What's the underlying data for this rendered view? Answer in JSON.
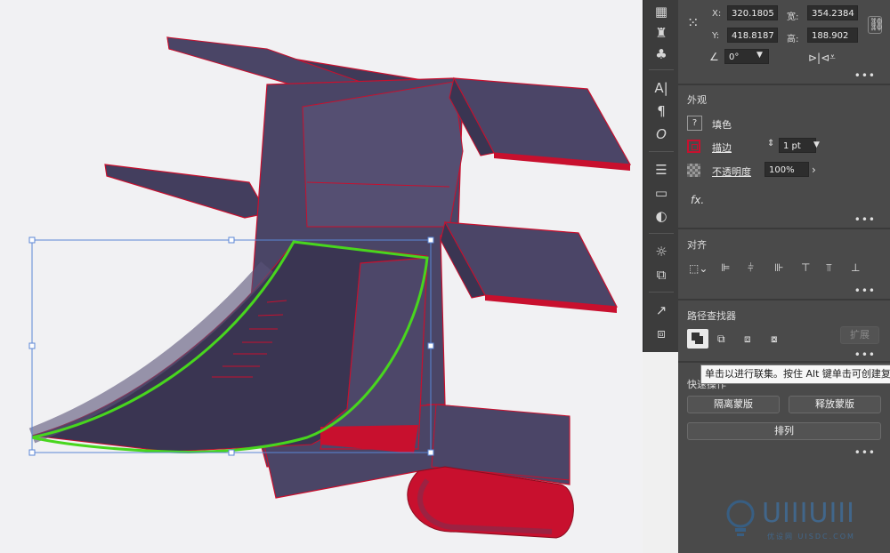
{
  "transform": {
    "x_label": "X:",
    "x_value": "320.1805",
    "y_label": "Y:",
    "y_value": "418.8187",
    "w_label": "宽:",
    "w_value": "354.2384",
    "h_label": "高:",
    "h_value": "188.902",
    "angle_value": "0°"
  },
  "appearance": {
    "title": "外观",
    "fill_label": "填色",
    "stroke_label": "描边",
    "stroke_weight": "1 pt",
    "opacity_label": "不透明度",
    "opacity_value": "100%",
    "fx_label": "fx."
  },
  "align": {
    "title": "对齐"
  },
  "pathfinder": {
    "title": "路径查找器",
    "expand_label": "扩展"
  },
  "tooltip": {
    "text": "单击以进行联集。按住 Alt 键单击可创建复"
  },
  "quick_actions": {
    "title": "快速操作",
    "isolate_mask": "隔离蒙版",
    "release_mask": "释放蒙版",
    "arrange": "排列"
  },
  "watermark": {
    "brand": "UIIIUIII",
    "sub": "优设网 UISDC.COM"
  },
  "colors": {
    "shape_fill": "#4a4566",
    "shape_stroke": "#c8102e",
    "selection": "#5b86d6",
    "highlight_path": "#48d61e"
  }
}
